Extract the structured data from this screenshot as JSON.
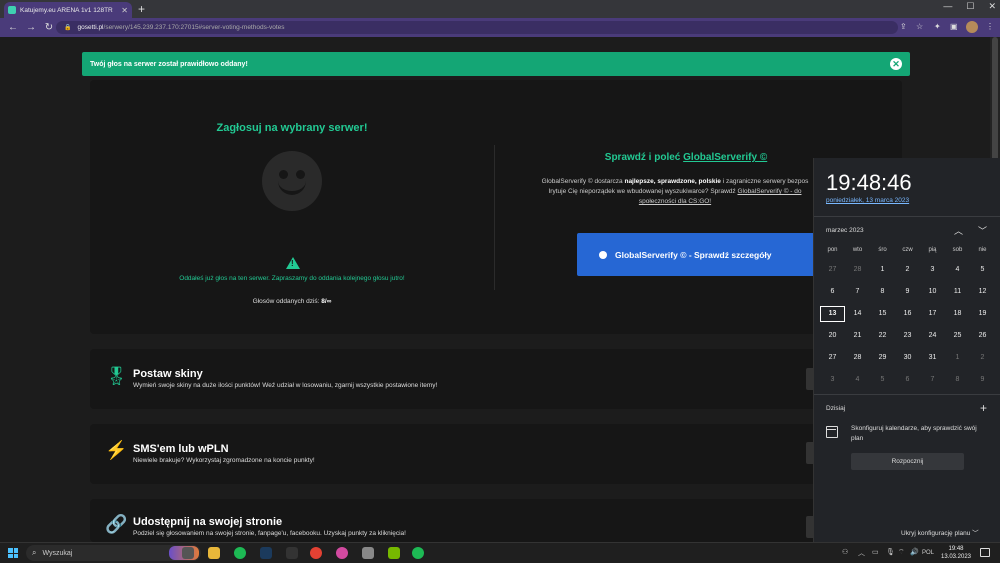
{
  "browser": {
    "tab_title": "Katujemy.eu ARENA 1v1 128TR",
    "url_host": "gosetti.pl",
    "url_path": "/serwery/145.239.237.170:27015#server-voting-methods-votes"
  },
  "toast": {
    "message": "Twój głos na serwer został prawidłowo oddany!"
  },
  "vote": {
    "title": "Zagłosuj na wybrany serwer!",
    "message": "Oddałeś już głos na ten serwer. Zapraszamy do oddania kolejnego głosu jutro!",
    "count_label": "Głosów oddanych dziś:",
    "count_value": "8/∞"
  },
  "globalserverify": {
    "title_prefix": "Sprawdź i poleć",
    "title_link": "GlobalServerify ©",
    "desc_1": "GlobalServerify © dostarcza",
    "desc_bold": "najlepsze, sprawdzone, polskie",
    "desc_2": "i zagraniczne serwery bezpos",
    "desc_3": "Irytuje Cię nieporządek we wbudowanej wyszukiwarce? Sprawdź",
    "desc_link": "GlobalServerify © - do",
    "desc_4": "społeczności dla CS:GO!",
    "button_label": "GlobalServerify © - Sprawdź szczegóły"
  },
  "features": [
    {
      "title": "Postaw skiny",
      "desc": "Wymień swoje skiny na duże ilości punktów! Weź udział w losowaniu, zgarnij wszystkie postawione itemy!"
    },
    {
      "title": "SMS'em lub wPLN",
      "desc": "Niewiele brakuje? Wykorzystaj zgromadzone na koncie punkty!"
    },
    {
      "title": "Udostępnij na swojej stronie",
      "desc": "Podziel się głosowaniem na swojej stronie, fanpage'u, facebooku. Uzyskaj punkty za kliknięcia!"
    }
  ],
  "calendar": {
    "clock": "19:48:46",
    "date_long": "poniedziałek, 13 marca 2023",
    "month": "marzec 2023",
    "weekdays": [
      "pon",
      "wto",
      "śro",
      "czw",
      "pią",
      "sob",
      "nie"
    ],
    "weeks": [
      [
        "27",
        "28",
        "1",
        "2",
        "3",
        "4",
        "5"
      ],
      [
        "6",
        "7",
        "8",
        "9",
        "10",
        "11",
        "12"
      ],
      [
        "13",
        "14",
        "15",
        "16",
        "17",
        "18",
        "19"
      ],
      [
        "20",
        "21",
        "22",
        "23",
        "24",
        "25",
        "26"
      ],
      [
        "27",
        "28",
        "29",
        "30",
        "31",
        "1",
        "2"
      ],
      [
        "3",
        "4",
        "5",
        "6",
        "7",
        "8",
        "9"
      ]
    ],
    "today_label": "Dzisiaj",
    "config_text": "Skonfiguruj kalendarze, aby sprawdzić swój plan",
    "start_button": "Rozpocznij",
    "hide_plan": "Ukryj konfigurację planu"
  },
  "taskbar": {
    "search_label": "Wyszukaj",
    "lang": "POL",
    "time": "19:48",
    "date": "13.03.2023"
  }
}
